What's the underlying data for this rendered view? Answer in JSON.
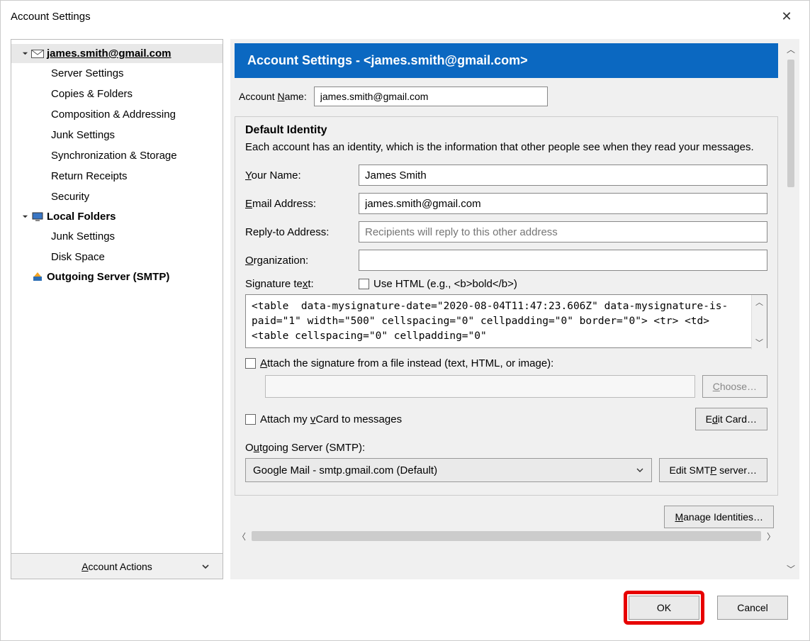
{
  "window": {
    "title": "Account Settings"
  },
  "sidebar": {
    "account_email": "james.smith@gmail.com",
    "items": [
      "Server Settings",
      "Copies & Folders",
      "Composition & Addressing",
      "Junk Settings",
      "Synchronization & Storage",
      "Return Receipts",
      "Security"
    ],
    "local_folders_label": "Local Folders",
    "local_items": [
      "Junk Settings",
      "Disk Space"
    ],
    "smtp_label": "Outgoing Server (SMTP)",
    "actions_label": "Account Actions"
  },
  "main": {
    "banner_prefix": "Account Settings - <",
    "banner_email": "james.smith@gmail.com",
    "banner_suffix": ">",
    "account_name_label": "Account Name:",
    "account_name_value": "james.smith@gmail.com",
    "identity_title": "Default Identity",
    "identity_desc": "Each account has an identity, which is the information that other people see when they read your messages.",
    "your_name_label": "Your Name:",
    "your_name_value": "James Smith",
    "email_label": "Email Address:",
    "email_value": "james.smith@gmail.com",
    "reply_label": "Reply-to Address:",
    "reply_placeholder": "Recipients will reply to this other address",
    "org_label": "Organization:",
    "org_value": "",
    "sig_text_label": "Signature text:",
    "use_html_label": "Use HTML (e.g., <b>bold</b>)",
    "signature_text": "<table  data-mysignature-date=\"2020-08-04T11:47:23.606Z\" data-mysignature-is-paid=\"1\" width=\"500\" cellspacing=\"0\" cellpadding=\"0\" border=\"0\"> <tr> <td> <table cellspacing=\"0\" cellpadding=\"0\"",
    "attach_file_label": "Attach the signature from a file instead (text, HTML, or image):",
    "choose_label": "Choose…",
    "attach_vcard_label": "Attach my vCard to messages",
    "edit_card_label": "Edit Card…",
    "smtp_section_label": "Outgoing Server (SMTP):",
    "smtp_value": "Google Mail - smtp.gmail.com (Default)",
    "edit_smtp_label": "Edit SMTP server…",
    "manage_identities_label": "Manage Identities…"
  },
  "footer": {
    "ok": "OK",
    "cancel": "Cancel"
  }
}
